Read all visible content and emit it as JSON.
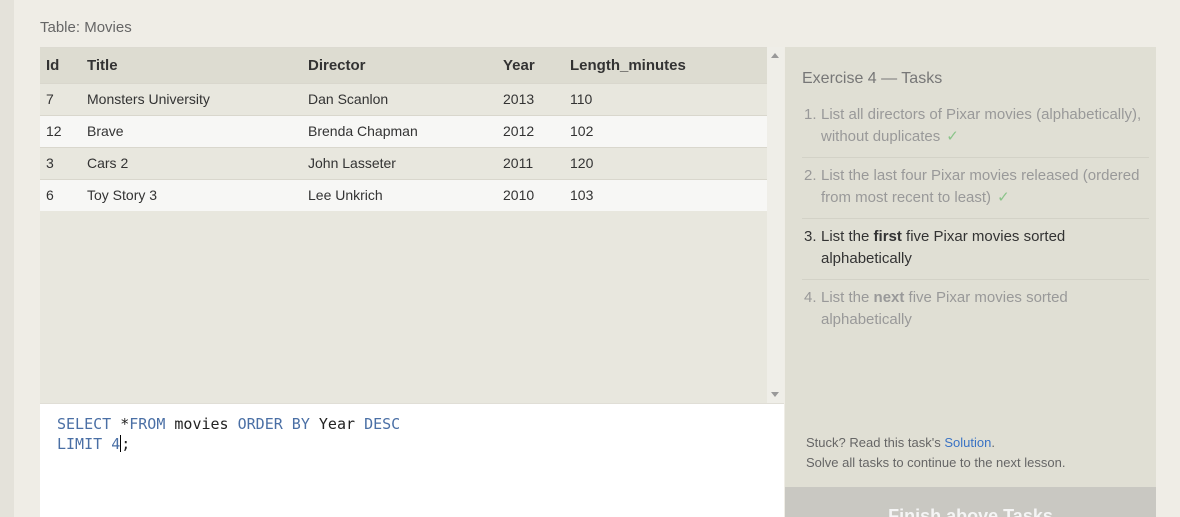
{
  "table": {
    "label": "Table: Movies",
    "columns": [
      "Id",
      "Title",
      "Director",
      "Year",
      "Length_minutes"
    ],
    "rows": [
      [
        "7",
        "Monsters University",
        "Dan Scanlon",
        "2013",
        "110"
      ],
      [
        "12",
        "Brave",
        "Brenda Chapman",
        "2012",
        "102"
      ],
      [
        "3",
        "Cars 2",
        "John Lasseter",
        "2011",
        "120"
      ],
      [
        "6",
        "Toy Story 3",
        "Lee Unkrich",
        "2010",
        "103"
      ]
    ]
  },
  "editor": {
    "line1": {
      "kw1": "SELECT",
      "sym": "*",
      "kw2": "FROM",
      "t1": "movies",
      "kw3": "ORDER BY",
      "t2": "Year",
      "kw4": "DESC"
    },
    "line2": {
      "kw1": "LIMIT",
      "num": "4",
      "end": ";"
    }
  },
  "tasks": {
    "title": "Exercise 4 — Tasks",
    "items": [
      {
        "num": "1.",
        "text": "List all directors of Pixar movies (alphabetically), without duplicates",
        "status": "done"
      },
      {
        "num": "2.",
        "text": "List the last four Pixar movies released (ordered from most recent to least)",
        "status": "done"
      },
      {
        "num": "3.",
        "pre": "List the ",
        "bold": "first",
        "post": " five Pixar movies sorted alphabetically",
        "status": "current"
      },
      {
        "num": "4.",
        "pre": "List the ",
        "bold": "next",
        "post": " five Pixar movies sorted alphabetically",
        "status": "upcoming"
      }
    ],
    "check_mark": "✓",
    "stuck_prefix": "Stuck? Read this task's ",
    "solution_link": "Solution",
    "stuck_suffix": ".",
    "solve_all": "Solve all tasks to continue to the next lesson.",
    "finish_button": "Finish above Tasks"
  },
  "colors": {
    "keyword": "#4a6fa5",
    "check": "#8bc48a",
    "link": "#3a73c4"
  }
}
